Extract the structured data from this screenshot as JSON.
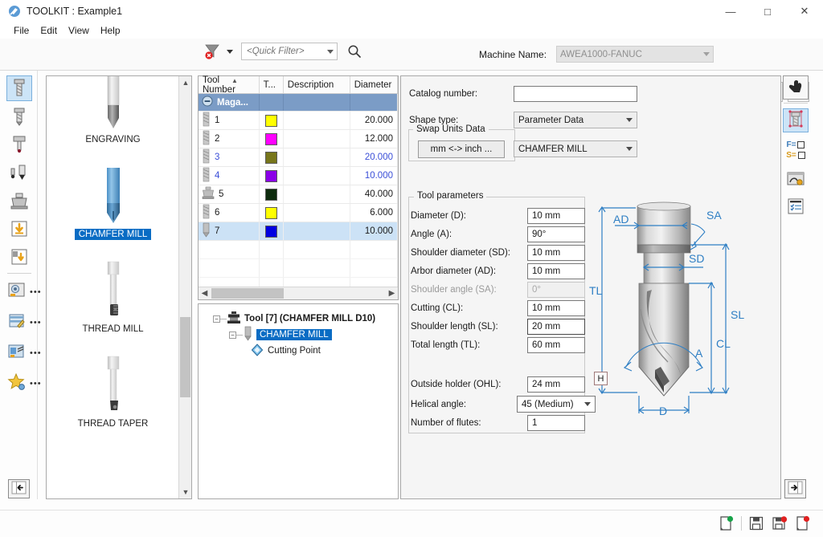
{
  "window": {
    "title": "TOOLKIT : Example1",
    "app_icon": "toolkit-icon",
    "minimize": "—",
    "maximize": "□",
    "close": "✕"
  },
  "menu": {
    "items": [
      "File",
      "Edit",
      "View",
      "Help"
    ]
  },
  "toolbar": {
    "filter_icon": "filter-clear-icon",
    "quick_filter_placeholder": "<Quick Filter>",
    "quick_filter_value": "",
    "search_icon": "search-icon",
    "machine_label": "Machine Name:",
    "machine_value": "AWEA1000-FANUC",
    "right_icons": [
      "preview-icon",
      "tool-view-icon",
      "tool-pick-icon"
    ]
  },
  "left_toolbar": {
    "items": [
      {
        "name": "tool-milling",
        "selected": true,
        "has_dots": false
      },
      {
        "name": "tool-drilling",
        "selected": false,
        "has_dots": false
      },
      {
        "name": "tool-boring",
        "selected": false,
        "has_dots": false
      },
      {
        "name": "tool-pair",
        "selected": false,
        "has_dots": false
      },
      {
        "name": "tool-holder",
        "selected": false,
        "has_dots": false
      },
      {
        "name": "tool-import",
        "selected": false,
        "has_dots": false
      },
      {
        "name": "tool-import-from",
        "selected": false,
        "has_dots": false
      },
      {
        "name": "tool-library",
        "selected": false,
        "has_dots": true
      },
      {
        "name": "tool-table-edit",
        "selected": false,
        "has_dots": true
      },
      {
        "name": "tool-assign",
        "selected": false,
        "has_dots": true
      },
      {
        "name": "tool-favorites",
        "selected": false,
        "has_dots": true
      }
    ],
    "collapse_icon": "collapse-left-icon"
  },
  "gallery": {
    "items": [
      {
        "label": "ENGRAVING",
        "shape": "engraving",
        "selected": false
      },
      {
        "label": "CHAMFER MILL",
        "shape": "chamfer",
        "selected": true
      },
      {
        "label": "THREAD MILL",
        "shape": "threadmill",
        "selected": false
      },
      {
        "label": "THREAD TAPER",
        "shape": "threadtaper",
        "selected": false
      }
    ],
    "scroll_up_icon": "chevron-up-icon",
    "scroll_down_icon": "chevron-down-icon"
  },
  "tool_table": {
    "columns": [
      "Tool Number",
      "T...",
      "Description",
      "Diameter"
    ],
    "sort_column": "Tool Number",
    "sort_direction": "asc",
    "group_row": {
      "label": "Maga...",
      "collapse_icon": "collapse-circle-icon"
    },
    "rows": [
      {
        "number": "1",
        "icon": "endmill-icon",
        "color": "#ffff00",
        "description": "",
        "diameter": "20.000",
        "selected": false,
        "modified": false
      },
      {
        "number": "2",
        "icon": "endmill-icon",
        "color": "#ff00ff",
        "description": "",
        "diameter": "12.000",
        "selected": false,
        "modified": false
      },
      {
        "number": "3",
        "icon": "endmill-icon",
        "color": "#77761b",
        "description": "",
        "diameter": "20.000",
        "selected": false,
        "modified": true
      },
      {
        "number": "4",
        "icon": "endmill-icon",
        "color": "#8b00e8",
        "description": "",
        "diameter": "10.000",
        "selected": false,
        "modified": true
      },
      {
        "number": "5",
        "icon": "holder-icon",
        "color": "#0d2b0d",
        "description": "",
        "diameter": "40.000",
        "selected": false,
        "modified": false
      },
      {
        "number": "6",
        "icon": "endmill-icon",
        "color": "#ffff00",
        "description": "",
        "diameter": "6.000",
        "selected": false,
        "modified": false
      },
      {
        "number": "7",
        "icon": "chamfer-icon",
        "color": "#0000e0",
        "description": "",
        "diameter": "10.000",
        "selected": true,
        "modified": false
      }
    ],
    "hscroll_left_icon": "chevron-left-icon",
    "hscroll_right_icon": "chevron-right-icon"
  },
  "tree": {
    "root": {
      "label": "Tool [7] (CHAMFER MILL D10)",
      "icon": "holder-icon",
      "expanded": true
    },
    "child": {
      "label": "CHAMFER MILL",
      "icon": "chamfer-icon",
      "expanded": true,
      "selected": true
    },
    "leaf": {
      "label": "Cutting Point",
      "icon": "cutting-point-icon"
    }
  },
  "form": {
    "catalog_label": "Catalog number:",
    "catalog_value": "",
    "shape_type_label": "Shape type:",
    "shape_type_value": "Parameter Data",
    "swap_units_group": "Swap Units Data",
    "swap_units_button": "mm <-> inch ...",
    "tool_type_value": "CHAMFER MILL",
    "parameters_group": "Tool parameters",
    "parameters": [
      {
        "label": "Diameter (D):",
        "value": "10 mm",
        "disabled": false,
        "focused": false
      },
      {
        "label": "Angle (A):",
        "value": "90°",
        "disabled": false,
        "focused": false
      },
      {
        "label": "Shoulder diameter (SD):",
        "value": "10 mm",
        "disabled": false,
        "focused": false
      },
      {
        "label": "Arbor diameter (AD):",
        "value": "10 mm",
        "disabled": false,
        "focused": false
      },
      {
        "label": "Shoulder angle (SA):",
        "value": "0°",
        "disabled": true,
        "focused": false
      },
      {
        "label": "Cutting (CL):",
        "value": "10 mm",
        "disabled": false,
        "focused": false
      },
      {
        "label": "Shoulder length (SL):",
        "value": "20 mm",
        "disabled": false,
        "focused": true
      },
      {
        "label": "Total length (TL):",
        "value": "60 mm",
        "disabled": false,
        "focused": false
      }
    ],
    "outside_holder_label": "Outside holder (OHL):",
    "outside_holder_value": "24 mm",
    "helical_angle_label": "Helical angle:",
    "helical_angle_value": "45 (Medium)",
    "flutes_label": "Number of flutes:",
    "flutes_value": "1",
    "h_badge": "H"
  },
  "diagram": {
    "name": "chamfer-mill-diagram",
    "dimension_labels": [
      "AD",
      "SA",
      "SD",
      "TL",
      "SL",
      "CL",
      "A",
      "D"
    ],
    "accent_color": "#2f7fc4"
  },
  "right_toolbar": {
    "items": [
      {
        "name": "pointer-hand-icon",
        "selected": false,
        "boxed": true
      },
      {
        "name": "tool-geometry-icon",
        "selected": true,
        "boxed": false
      },
      {
        "name": "feed-speed-icon",
        "selected": false,
        "boxed": false
      },
      {
        "name": "tool-database-icon",
        "selected": false,
        "boxed": false
      },
      {
        "name": "tool-checklist-icon",
        "selected": false,
        "boxed": false
      }
    ],
    "feed_label": "F=",
    "speed_label": "S=",
    "expand_icon": "expand-right-icon"
  },
  "status_bar": {
    "icons": [
      "new-document-icon",
      "save-icon",
      "save-as-icon",
      "close-document-icon"
    ]
  },
  "colors": {
    "accent": "#0a6cc4",
    "selection": "#cce2f6",
    "group_row": "#7b9cc6",
    "diagram_blue": "#2f7fc4",
    "panel_bg": "#f5f5f5"
  }
}
